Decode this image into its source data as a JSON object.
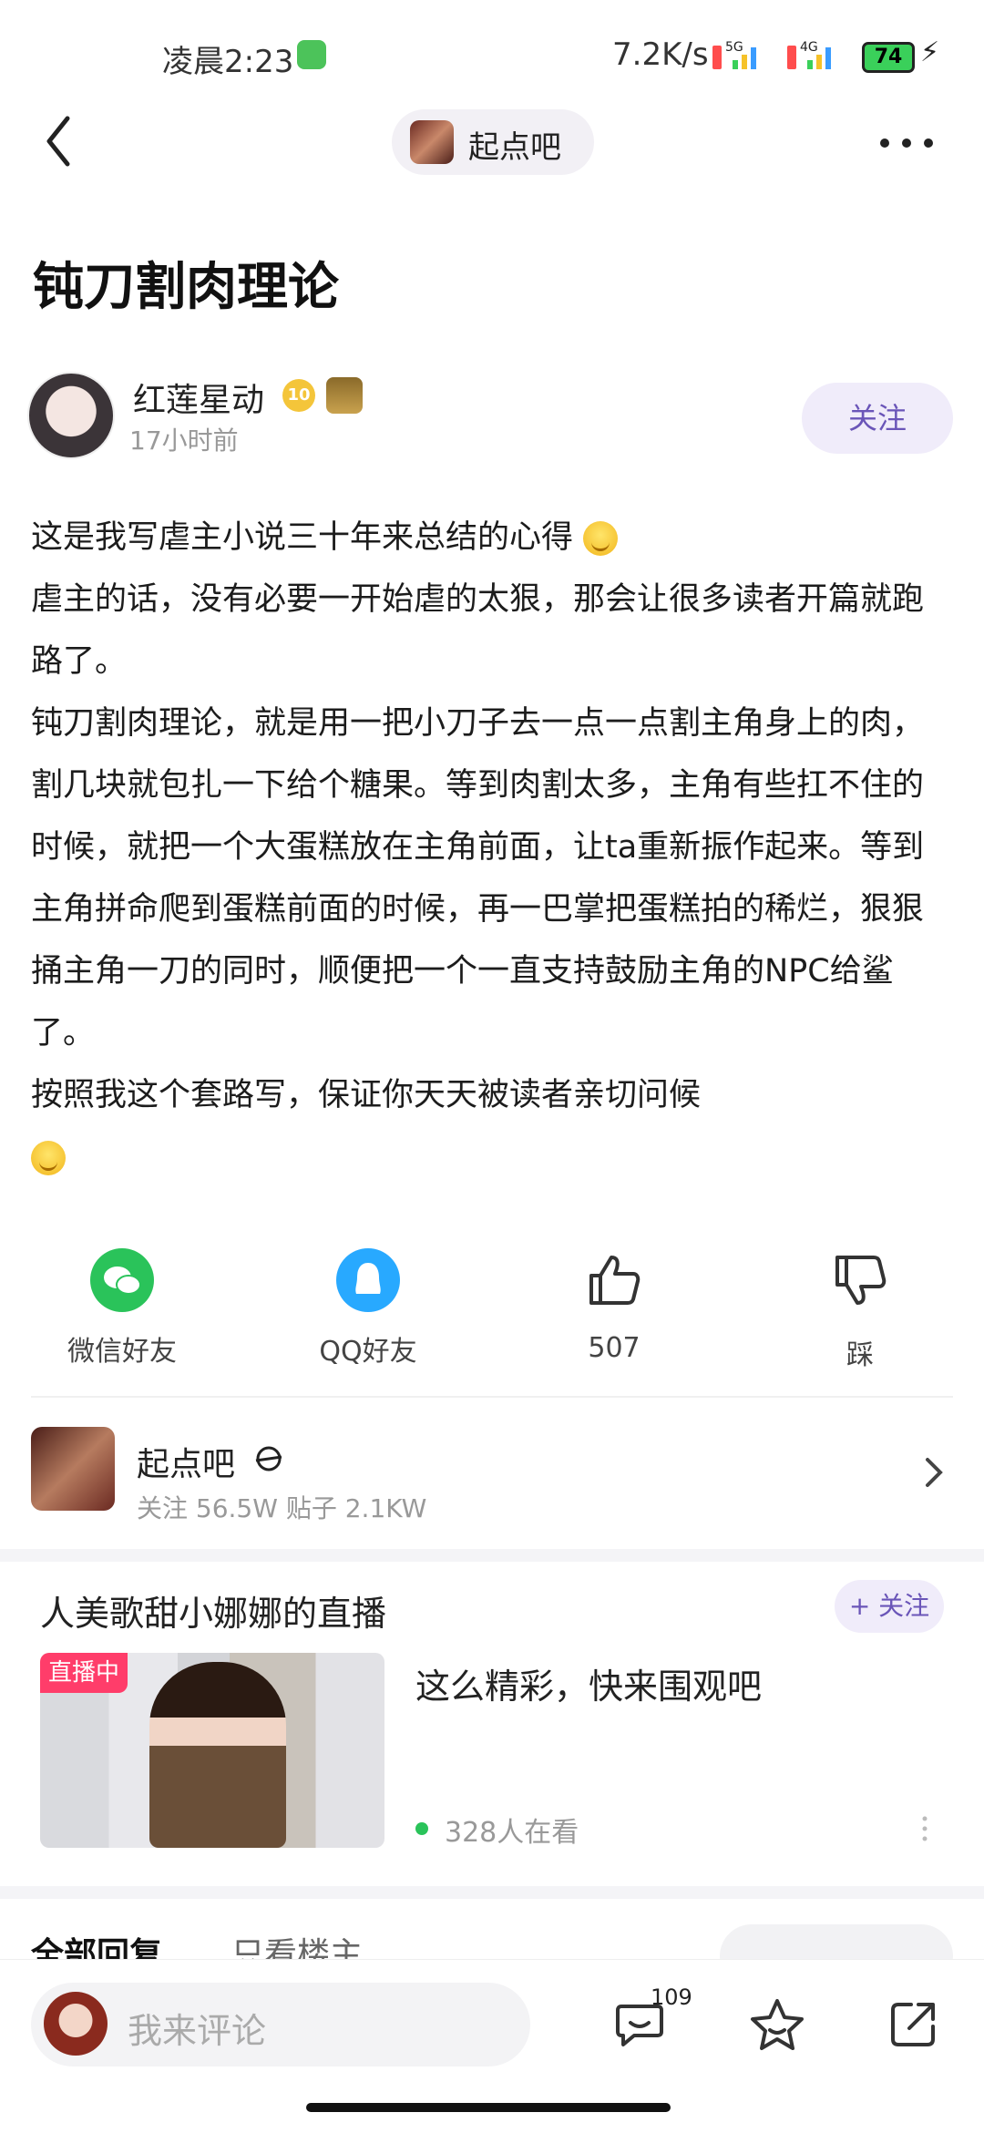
{
  "status_bar": {
    "time": "凌晨2:23",
    "net_speed": "7.2K/s",
    "signal_1": "5G",
    "signal_2": "4G",
    "battery": "74"
  },
  "nav": {
    "forum_name": "起点吧"
  },
  "post": {
    "title": "钝刀割肉理论",
    "author": "红莲星动",
    "level": "10",
    "time": "17小时前",
    "follow_label": "关注",
    "paragraphs": [
      "这是我写虐主小说三十年来总结的心得",
      "虐主的话，没有必要一开始虐的太狠，那会让很多读者开篇就跑路了。",
      "钝刀割肉理论，就是用一把小刀子去一点一点割主角身上的肉，割几块就包扎一下给个糖果。等到肉割太多，主角有些扛不住的时候，就把一个大蛋糕放在主角前面，让ta重新振作起来。等到主角拼命爬到蛋糕前面的时候，再一巴掌把蛋糕拍的稀烂，狠狠捅主角一刀的同时，顺便把一个一直支持鼓励主角的NPC给鲨了。",
      "按照我这个套路写，保证你天天被读者亲切问候"
    ]
  },
  "share": {
    "wechat": "微信好友",
    "qq": "QQ好友",
    "like_count": "507",
    "dislike": "踩"
  },
  "forum_card": {
    "name": "起点吧",
    "stats": "关注 56.5W   贴子 2.1KW"
  },
  "live": {
    "title": "人美歌甜小娜娜的直播",
    "follow_label": "+ 关注",
    "tag": "直播中",
    "headline": "这么精彩，快来围观吧",
    "viewers": "328人在看"
  },
  "reply_tabs": {
    "all": "全部回复",
    "owner_only": "只看楼主"
  },
  "bottom_bar": {
    "comment_placeholder": "我来评论",
    "comment_count": "109"
  },
  "colors": {
    "accent": "#6a55b8",
    "wechat": "#2ac35a",
    "qq": "#28a9ff",
    "live_tag": "#ff3d6a"
  }
}
